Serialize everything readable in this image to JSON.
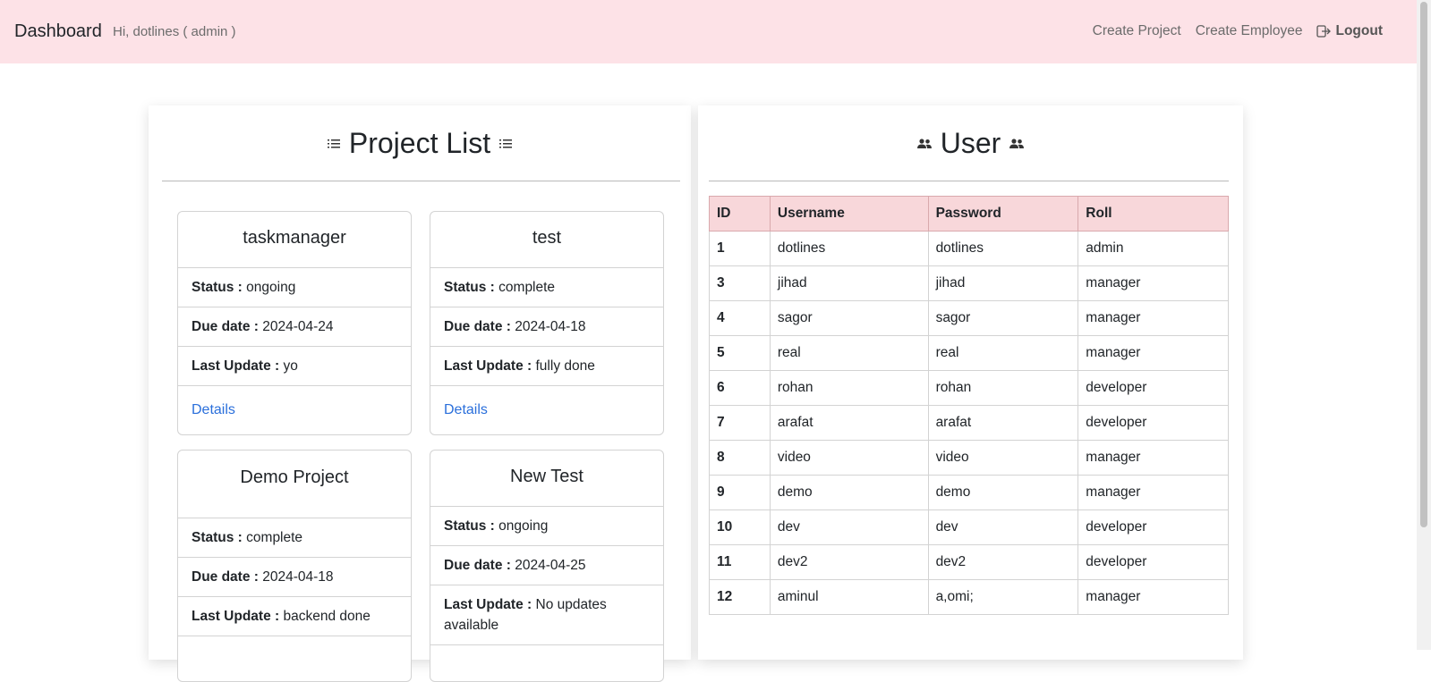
{
  "navbar": {
    "brand": "Dashboard",
    "greeting": "Hi, dotlines ( admin )",
    "create_project": "Create Project",
    "create_employee": "Create Employee",
    "logout": "Logout"
  },
  "projects": {
    "title": "Project List",
    "labels": {
      "status": "Status :",
      "due": "Due date :",
      "update": "Last Update :"
    },
    "cards": [
      {
        "name": "taskmanager",
        "status": "ongoing",
        "due": "2024-04-24",
        "update": "yo",
        "link": "Details"
      },
      {
        "name": "test",
        "status": "complete",
        "due": "2024-04-18",
        "update": "fully done",
        "link": "Details"
      },
      {
        "name": "Demo Project",
        "status": "complete",
        "due": "2024-04-18",
        "update": "backend done"
      },
      {
        "name": "New Test",
        "status": "ongoing",
        "due": "2024-04-25",
        "update": "No updates available"
      }
    ]
  },
  "users": {
    "title": "User",
    "columns": [
      "ID",
      "Username",
      "Password",
      "Roll"
    ],
    "rows": [
      [
        "1",
        "dotlines",
        "dotlines",
        "admin"
      ],
      [
        "3",
        "jihad",
        "jihad",
        "manager"
      ],
      [
        "4",
        "sagor",
        "sagor",
        "manager"
      ],
      [
        "5",
        "real",
        "real",
        "manager"
      ],
      [
        "6",
        "rohan",
        "rohan",
        "developer"
      ],
      [
        "7",
        "arafat",
        "arafat",
        "developer"
      ],
      [
        "8",
        "video",
        "video",
        "manager"
      ],
      [
        "9",
        "demo",
        "demo",
        "manager"
      ],
      [
        "10",
        "dev",
        "dev",
        "developer"
      ],
      [
        "11",
        "dev2",
        "dev2",
        "developer"
      ],
      [
        "12",
        "aminul",
        "a,omi;",
        "manager"
      ]
    ]
  }
}
